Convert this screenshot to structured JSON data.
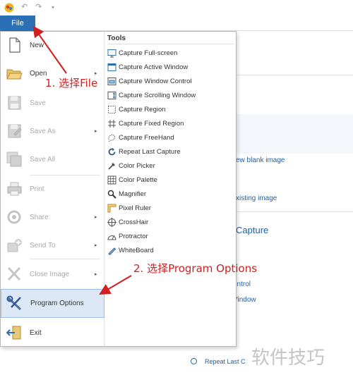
{
  "titlebar": {
    "quick_access": [
      "undo-icon",
      "redo-icon",
      "customize-icon"
    ],
    "qa_glyphs": {
      "undo": "↶",
      "redo": "↷",
      "customize": "▾"
    }
  },
  "ribbon": {
    "file_tab": "File"
  },
  "menu": {
    "items": [
      {
        "name": "new",
        "label": "New",
        "icon": "new-document-icon",
        "enabled": true,
        "submenu": false
      },
      {
        "name": "open",
        "label": "Open",
        "icon": "open-folder-icon",
        "enabled": true,
        "submenu": true
      },
      {
        "name": "save",
        "label": "Save",
        "icon": "save-icon",
        "enabled": false,
        "submenu": false
      },
      {
        "name": "save-as",
        "label": "Save As",
        "icon": "save-as-icon",
        "enabled": false,
        "submenu": true
      },
      {
        "name": "save-all",
        "label": "Save All",
        "icon": "save-all-icon",
        "enabled": false,
        "submenu": false
      },
      {
        "name": "print",
        "label": "Print",
        "icon": "printer-icon",
        "enabled": false,
        "submenu": false
      },
      {
        "name": "share",
        "label": "Share",
        "icon": "share-icon",
        "enabled": false,
        "submenu": true
      },
      {
        "name": "send-to",
        "label": "Send To",
        "icon": "send-to-icon",
        "enabled": false,
        "submenu": true
      },
      {
        "name": "close-image",
        "label": "Close Image",
        "icon": "close-icon",
        "enabled": false,
        "submenu": true
      },
      {
        "name": "program-options",
        "label": "Program Options",
        "icon": "wrench-screwdriver-icon",
        "enabled": true,
        "submenu": false
      },
      {
        "name": "exit",
        "label": "Exit",
        "icon": "exit-icon",
        "enabled": true,
        "submenu": false
      }
    ],
    "submenu_arrow": "▸",
    "highlighted": "program-options"
  },
  "tools": {
    "heading": "Tools",
    "items": [
      {
        "label": "Capture Full-screen",
        "icon": "monitor-icon"
      },
      {
        "label": "Capture Active Window",
        "icon": "active-window-icon"
      },
      {
        "label": "Capture Window Control",
        "icon": "window-control-icon"
      },
      {
        "label": "Capture Scrolling Window",
        "icon": "scrolling-window-icon"
      },
      {
        "label": "Capture Region",
        "icon": "region-icon"
      },
      {
        "label": "Capture Fixed Region",
        "icon": "fixed-region-icon"
      },
      {
        "label": "Capture FreeHand",
        "icon": "freehand-icon"
      },
      {
        "label": "Repeat Last Capture",
        "icon": "repeat-icon"
      },
      {
        "label": "Color Picker",
        "icon": "eyedropper-icon"
      },
      {
        "label": "Color Palette",
        "icon": "palette-grid-icon"
      },
      {
        "label": "Magnifier",
        "icon": "magnifier-icon"
      },
      {
        "label": "Pixel Ruler",
        "icon": "ruler-icon"
      },
      {
        "label": "CrossHair",
        "icon": "crosshair-icon"
      },
      {
        "label": "Protractor",
        "icon": "protractor-icon"
      },
      {
        "label": "WhiteBoard",
        "icon": "pen-icon"
      }
    ]
  },
  "background": {
    "link_new_blank": "ew blank image",
    "link_existing": "xisting image",
    "section_title": "Capture",
    "link_control": "ontrol",
    "link_window": "Vindow",
    "link_repeat_last": "Repeat Last C"
  },
  "annotations": {
    "step1": "1. 选择File",
    "step2": "2. 选择Program Options",
    "color": "#d21f1f"
  },
  "watermark": "软件技巧",
  "colors": {
    "file_tab": "#2b6fb5",
    "link": "#1f5fa6",
    "highlight": "#dce8f5"
  }
}
